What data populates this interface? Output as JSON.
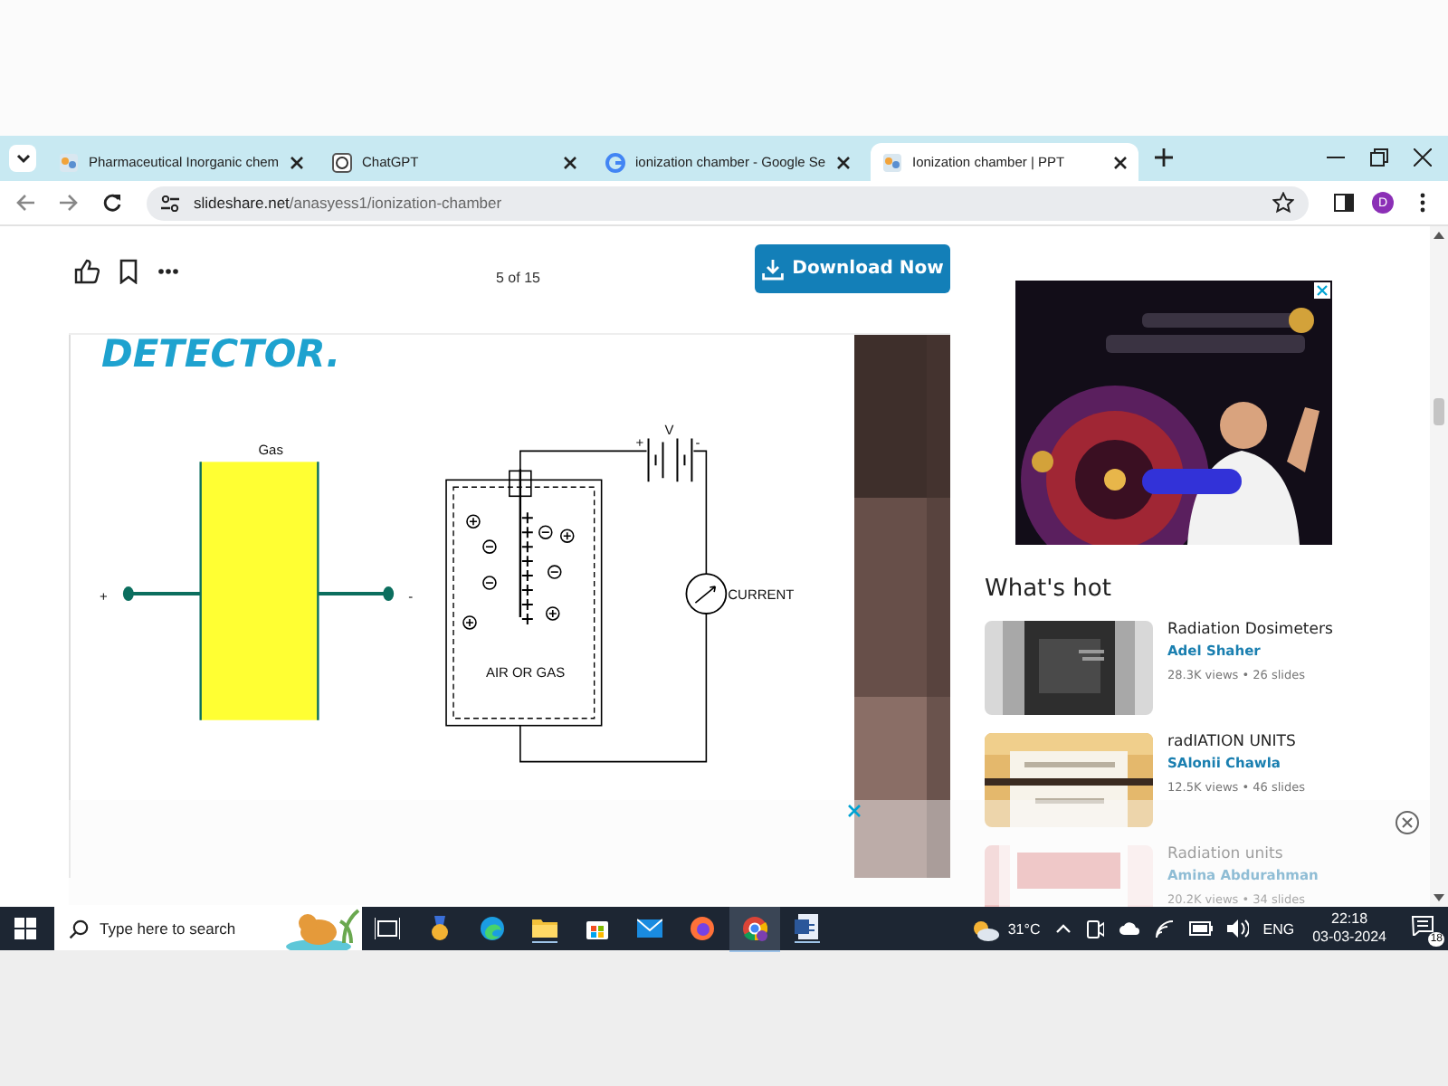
{
  "browser": {
    "tabs": [
      {
        "title": "Pharmaceutical Inorganic chem",
        "selected": false
      },
      {
        "title": "ChatGPT",
        "selected": false
      },
      {
        "title": "ionization chamber - Google Se",
        "selected": false
      },
      {
        "title": "Ionization chamber | PPT",
        "selected": true
      }
    ],
    "address": {
      "domain": "slideshare.net",
      "path": "/anasyess1/ionization-chamber"
    },
    "profile_initial": "D"
  },
  "viewer": {
    "page_indicator": "5 of 15",
    "download_button": "Download Now"
  },
  "slide": {
    "heading": "DETECTOR.",
    "gas_label": "Gas",
    "left_plus": "+",
    "left_minus": "-",
    "voltage_label": "V",
    "battery_plus": "+",
    "battery_minus": "-",
    "meter_label": "CURRENT",
    "chamber_label": "AIR OR GAS"
  },
  "whats_hot": {
    "title": "What's hot",
    "items": [
      {
        "title": "Radiation Dosimeters",
        "author": "Adel Shaher",
        "meta": "28.3K views • 26 slides"
      },
      {
        "title": "radIATION UNITS",
        "author": "SAlonii Chawla",
        "meta": "12.5K views • 46 slides"
      },
      {
        "title": "Radiation units",
        "author": "Amina Abdurahman",
        "meta": "20.2K views • 34 slides"
      }
    ]
  },
  "taskbar": {
    "search_placeholder": "Type here to search",
    "temperature": "31°C",
    "language": "ENG",
    "time": "22:18",
    "date": "03-03-2024",
    "notification_count": "18"
  }
}
